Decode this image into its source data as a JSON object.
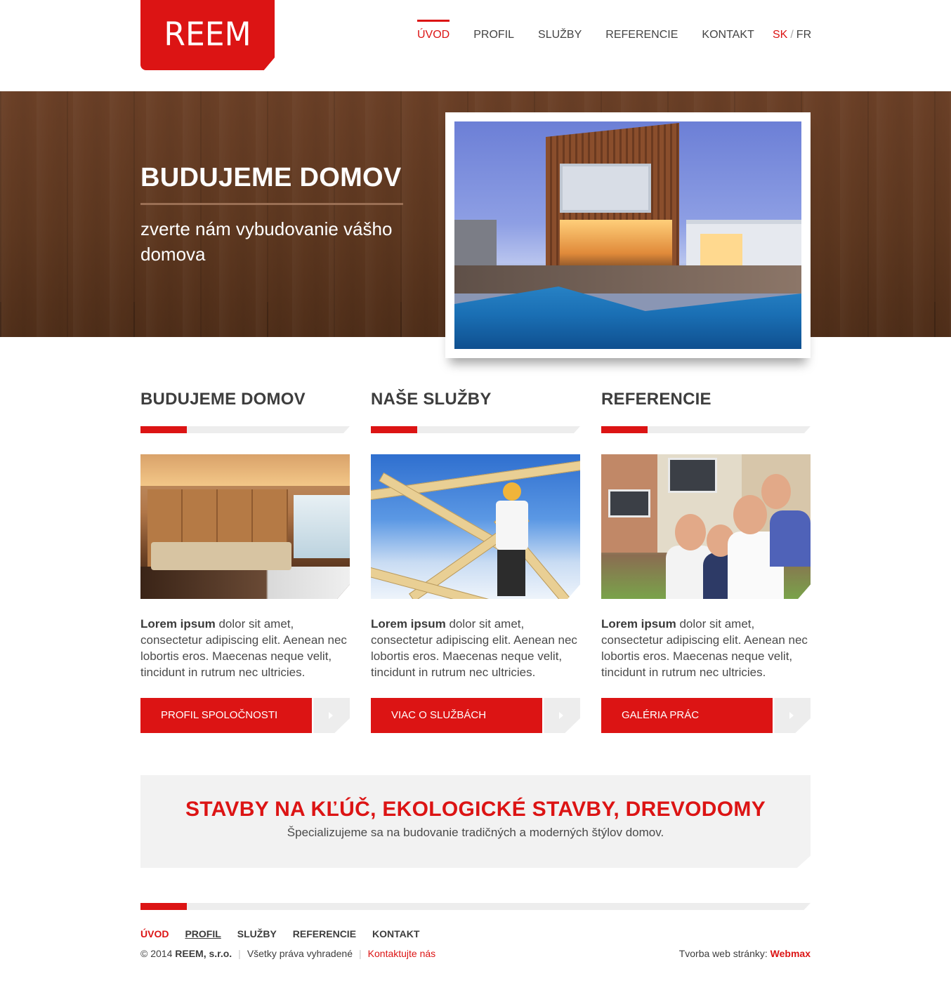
{
  "logo": {
    "text": "REEM"
  },
  "nav": {
    "items": [
      {
        "label": "ÚVOD",
        "active": true
      },
      {
        "label": "PROFIL",
        "active": false
      },
      {
        "label": "SLUŽBY",
        "active": false
      },
      {
        "label": "REFERENCIE",
        "active": false
      },
      {
        "label": "KONTAKT",
        "active": false
      }
    ],
    "lang": {
      "sk": "SK",
      "separator": "/",
      "fr": "FR",
      "active": "SK"
    }
  },
  "hero": {
    "title": "BUDUJEME DOMOV",
    "subtitle": "zverte nám vybudovanie vášho domova"
  },
  "columns": [
    {
      "title": "BUDUJEME DOMOV",
      "text_bold": "Lorem ipsum",
      "text": " dolor sit amet, consectetur adipiscing elit. Aenean nec lobortis eros. Maecenas neque velit, tincidunt in rutrum nec ultricies.",
      "button": "PROFIL SPOLOČNOSTI"
    },
    {
      "title": "NAŠE SLUŽBY",
      "text_bold": "Lorem ipsum",
      "text": " dolor sit amet, consectetur adipiscing elit. Aenean nec lobortis eros. Maecenas neque velit, tincidunt in rutrum nec ultricies.",
      "button": "VIAC O SLUŽBÁCH"
    },
    {
      "title": "REFERENCIE",
      "text_bold": "Lorem ipsum",
      "text": " dolor sit amet, consectetur adipiscing elit. Aenean nec lobortis eros. Maecenas neque velit, tincidunt in rutrum nec ultricies.",
      "button": "GALÉRIA PRÁC"
    }
  ],
  "banner": {
    "title": "STAVBY NA KĽÚČ, EKOLOGICKÉ STAVBY, DREVODOMY",
    "subtitle": "Špecializujeme sa na budovanie tradičných a moderných štýlov domov."
  },
  "footer": {
    "nav": [
      {
        "label": "ÚVOD",
        "active": true
      },
      {
        "label": "PROFIL",
        "active": false
      },
      {
        "label": "SLUŽBY",
        "active": false
      },
      {
        "label": "REFERENCIE",
        "active": false
      },
      {
        "label": "KONTAKT",
        "active": false
      }
    ],
    "copyright_prefix": "© 2014",
    "company": "REEM, s.r.o.",
    "rights": "Všetky práva vyhradené",
    "contact_link": "Kontaktujte nás",
    "credit_prefix": "Tvorba web stránky:",
    "credit_brand": "Webmax"
  },
  "colors": {
    "accent": "#dc1414",
    "text": "#3d3d3d",
    "light_gray": "#ededed",
    "wood": "#5e3820"
  }
}
